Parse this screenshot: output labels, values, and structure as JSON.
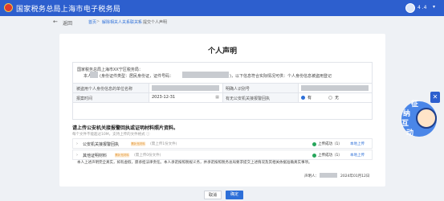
{
  "header": {
    "site_title": "国家税务总局上海市电子税务局",
    "user_name": "4 .4",
    "user_caret": "▾"
  },
  "breadcrumb": {
    "back_icon": "←",
    "back_label": "返回",
    "items": [
      "首页",
      "解除相关人关系联关系",
      "提交个人声明"
    ],
    "separator": ">"
  },
  "document": {
    "title": "个人声明",
    "addressee": "国家税务总局上海市XX宁区税务局：",
    "line_start": "本人",
    "line_mid": "(身份证件类型：居民身份证，证件号码：",
    "line_end": ")，以下信息符合实际情况可供：个人身份信息被盗用登记",
    "labels": {
      "company_id": "被盗用个人身份信息的单位名称",
      "taxpayer_id": "明确人识别号",
      "report_time": "报案时间",
      "relation": "有无公安机关接报警回执"
    },
    "report_date": "2023-12-31",
    "radio_yes": "有",
    "radio_no": "无",
    "relation_selected": "有"
  },
  "uploads": {
    "title": "请上传公安机关接报警回执或证明材料照片资料。",
    "hint": "每个文件不能超过10M，支持上传的文件格式 ⓘ",
    "items": [
      {
        "name": "公安机关接报警回执",
        "tag": "需补充材料",
        "note": "(需上传1份文件)",
        "status": "上传成功（1）",
        "action": "本地上传"
      },
      {
        "name": "其他证明材料",
        "tag": "需补充材料",
        "note": "(需上传0份文件)",
        "status": "上传成功（1）",
        "action": "本地上传"
      }
    ]
  },
  "promise": "本人上述声明完全真实，如有虚假，愿承担法律责任。本人承诺按照税规义务，并承诺按照税务总局要求提交上述情况及其相关依据准确真实事项。",
  "signature": {
    "label": "声明人：",
    "date": "2024年01月12日"
  },
  "footer": {
    "cancel_label": "取消",
    "confirm_label": "确定"
  },
  "mascot": {
    "chars": [
      "征",
      "纳",
      "互",
      "动"
    ],
    "tab_icon": "✕"
  },
  "colors": {
    "primary": "#2d5fce",
    "link": "#2d6fd8",
    "success": "#26a65b",
    "tag": "#e08a1e"
  }
}
